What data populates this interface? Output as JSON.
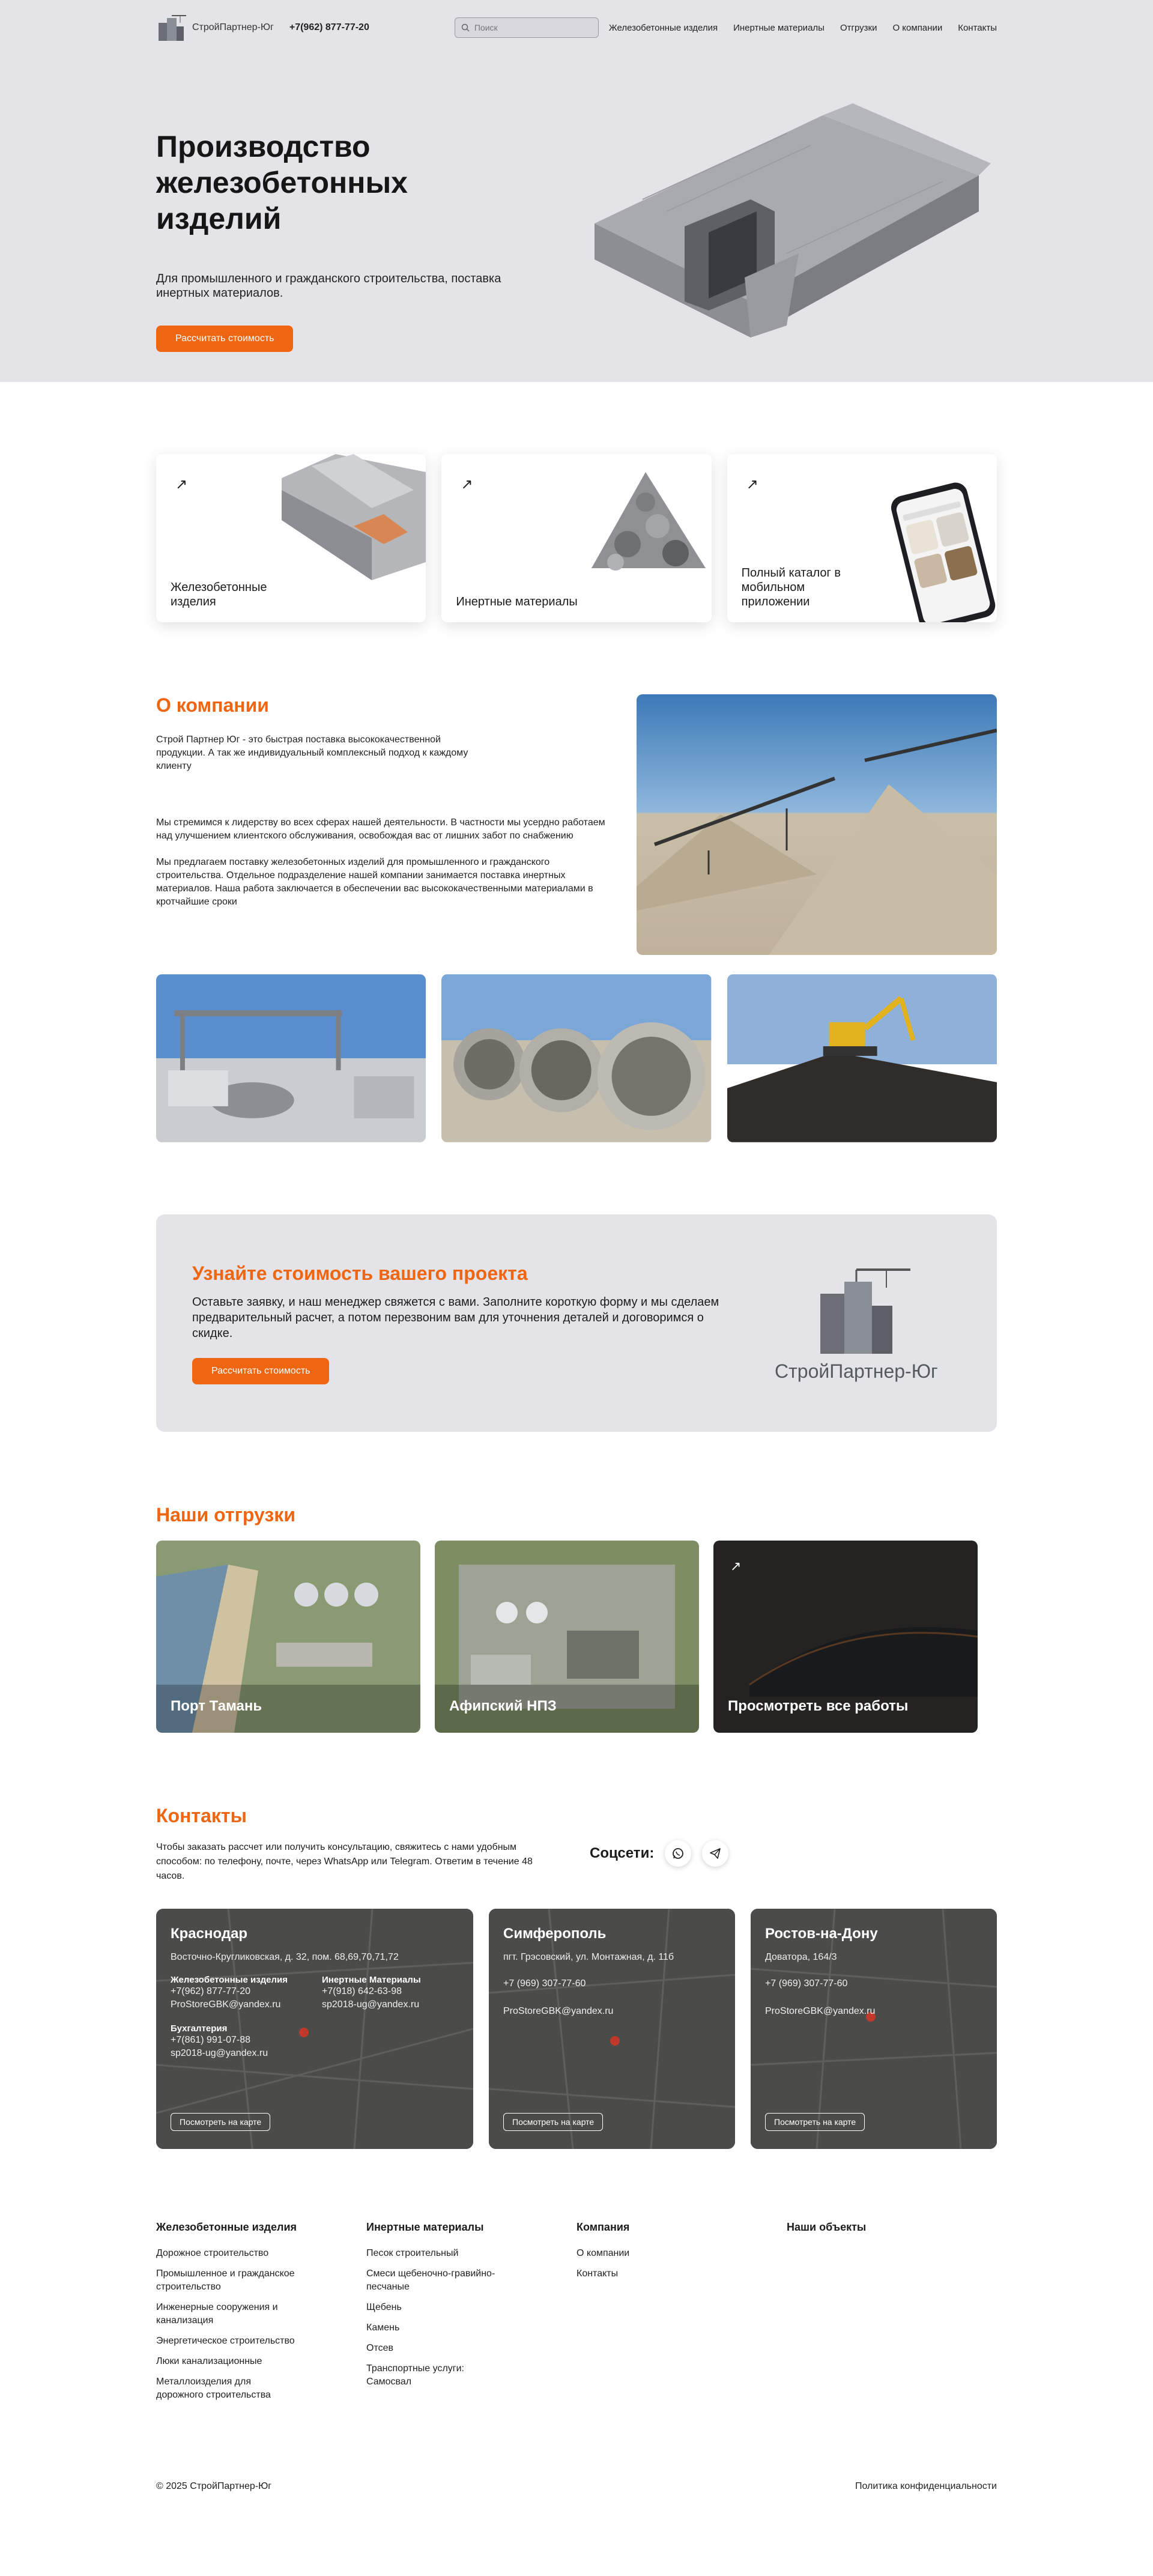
{
  "header": {
    "brand": "СтройПартнер-Юг",
    "phone": "+7(962) 877-77-20",
    "search_placeholder": "Поиск",
    "nav": [
      "Железобетонные изделия",
      "Инертные материалы",
      "Отгрузки",
      "О компании",
      "Контакты"
    ]
  },
  "hero": {
    "title_line1": "Производство",
    "title_line2": "железобетонных изделий",
    "subtitle": "Для промышленного и гражданского строительства, поставка инертных материалов.",
    "button": "Рассчитать стоимость"
  },
  "cards": [
    {
      "label": "Железобетонные изделия"
    },
    {
      "label": "Инертные материалы"
    },
    {
      "label": "Полный каталог в мобильном приложении"
    }
  ],
  "about": {
    "title": "О компании",
    "p1": "Строй Партнер Юг - это быстрая поставка  высококачественной продукции. А так же индивидуальный комплексный подход к каждому клиенту",
    "p2": "Мы стремимся к лидерству во всех сферах нашей деятельности. В частности мы усердно работаем над улучшением клиентского обслуживания, освобождая вас от лишних забот по снабжению",
    "p3": "Мы предлагаем поставку железобетонных изделий  для промышленного и гражданского строительства.  Отдельное подразделение нашей компании занимается поставка инертных материалов. Наша работа заключается в обеспечении  вас высококачественными материалами в кротчайшие сроки"
  },
  "cta": {
    "title": "Узнайте стоимость вашего проекта",
    "text": "Оставьте заявку, и наш менеджер свяжется с вами. Заполните короткую форму и мы сделаем предварительный расчет, а потом перезвоним вам для уточнения деталей и договоримся о скидке.",
    "button": "Рассчитать стоимость",
    "logo_name": "СтройПартнер-Юг"
  },
  "shipments": {
    "title": "Наши отгрузки",
    "items": [
      "Порт Тамань",
      "Афипский НПЗ",
      "Просмотреть все работы"
    ]
  },
  "contacts": {
    "title": "Контакты",
    "text": "Чтобы заказать рассчет или получить консультацию, свяжитесь с нами удобным способом: по телефону, почте, через WhatsApp или Telegram. Ответим в течение 48 часов.",
    "socials_label": "Соцсети:",
    "map_button": "Посмотреть на карте",
    "offices": [
      {
        "city": "Краснодар",
        "address": "Восточно-Кругликовская, д. 32, пом. 68,69,70,71,72",
        "col1_title": "Железобетонные изделия",
        "col1_phone": "+7(962) 877-77-20",
        "col1_email": "ProStoreGBK@yandex.ru",
        "col2_title": "Инертные Материалы",
        "col2_phone": "+7(918) 642-63-98",
        "col2_email": "sp2018-ug@yandex.ru",
        "acc_title": "Бухгалтерия",
        "acc_phone": "+7(861) 991-07-88",
        "acc_email": "sp2018-ug@yandex.ru"
      },
      {
        "city": "Симферополь",
        "address": "пгт. Грэсовский, ул. Монтажная, д. 11б",
        "phone": "+7 (969) 307-77-60",
        "email": "ProStoreGBK@yandex.ru"
      },
      {
        "city": "Ростов-на-Дону",
        "address": "Доватора, 164/3",
        "phone": "+7 (969) 307-77-60",
        "email": "ProStoreGBK@yandex.ru"
      }
    ]
  },
  "footer": {
    "col1": {
      "title": "Железобетонные изделия",
      "links": [
        "Дорожное строительство",
        "Промышленное и гражданское строительство",
        "Инженерные сооружения и канализация",
        "Энергетическое строительство",
        "Люки канализационные",
        "Металлоизделия для дорожного строительства"
      ]
    },
    "col2": {
      "title": "Инертные материалы",
      "links": [
        "Песок строительный",
        "Смеси щебеночно-гравийно-песчаные",
        "Щебень",
        "Камень",
        "Отсев",
        "Транспортные услуги: Самосвал"
      ]
    },
    "col3": {
      "title": "Компания",
      "links": [
        "О компании",
        "Контакты"
      ]
    },
    "col4": {
      "title": "Наши объекты"
    },
    "copyright": "© 2025 СтройПартнер-Юг",
    "privacy": "Политика конфиденциальности"
  }
}
